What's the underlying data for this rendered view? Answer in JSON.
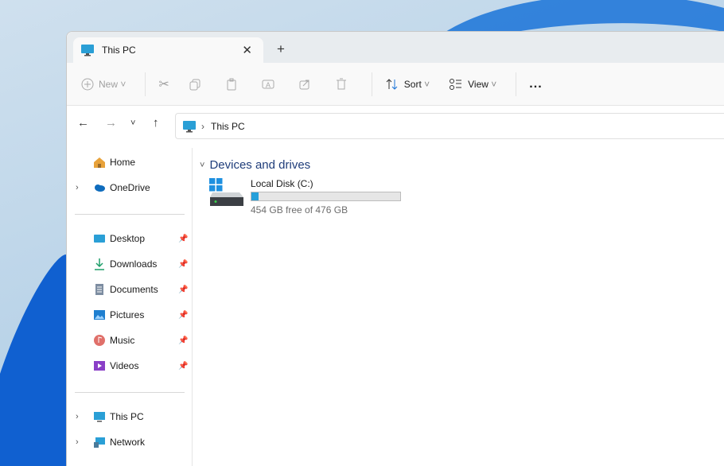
{
  "tab": {
    "title": "This PC"
  },
  "toolbar": {
    "new": "New",
    "sort": "Sort",
    "view": "View",
    "more": "..."
  },
  "address": {
    "path": "This PC"
  },
  "sidebar": {
    "items": [
      {
        "label": "Home"
      },
      {
        "label": "OneDrive"
      },
      {
        "label": "Desktop"
      },
      {
        "label": "Downloads"
      },
      {
        "label": "Documents"
      },
      {
        "label": "Pictures"
      },
      {
        "label": "Music"
      },
      {
        "label": "Videos"
      },
      {
        "label": "This PC"
      },
      {
        "label": "Network"
      }
    ]
  },
  "main": {
    "group": "Devices and drives",
    "drive": {
      "name": "Local Disk (C:)",
      "info": "454 GB free of 476 GB",
      "used_fraction": 0.046
    }
  },
  "colors": {
    "accent": "#26a0da",
    "header": "#1f3d7a"
  }
}
